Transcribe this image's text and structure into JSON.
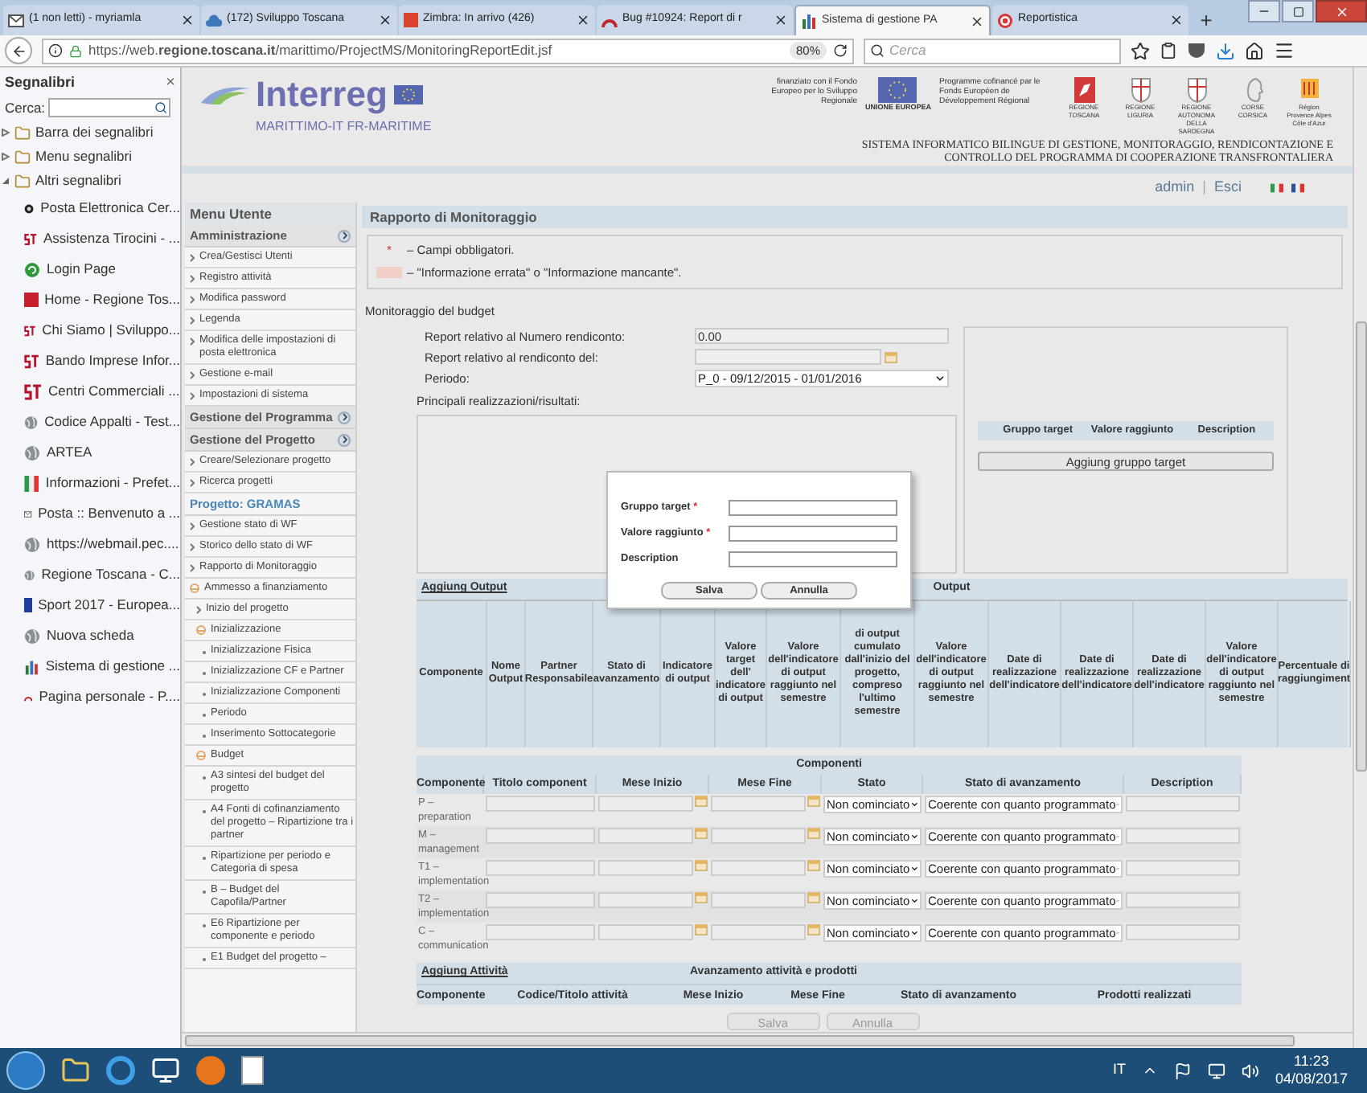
{
  "browser": {
    "tabs": [
      {
        "title": "(1 non letti) - myriamla",
        "kind": "mail",
        "selected": false
      },
      {
        "title": "(172) Sviluppo Toscana",
        "kind": "cloud",
        "selected": false
      },
      {
        "title": "Zimbra: In arrivo (426)",
        "kind": "color",
        "color": "#d9442b",
        "selected": false
      },
      {
        "title": "Bug #10924: Report di r",
        "kind": "arc",
        "selected": false
      },
      {
        "title": "Sistema di gestione PA",
        "kind": "bars",
        "selected": true
      },
      {
        "title": "Reportistica",
        "kind": "target",
        "selected": false
      }
    ],
    "new_tab": "+",
    "url": "https://web.**regione.toscana.it**/marittimo/ProjectMS/MonitoringReportEdit.jsf",
    "zoom": "80%",
    "search_placeholder": "Cerca"
  },
  "bookmarks": {
    "title": "Segnalibri",
    "close": "×",
    "search_label": "Cerca:",
    "folders": [
      {
        "label": "Barra dei segnalibri",
        "expanded": false
      },
      {
        "label": "Menu segnalibri",
        "expanded": false
      },
      {
        "label": "Altri segnalibri",
        "expanded": true,
        "children": [
          {
            "label": "Posta Elettronica Cer...",
            "kind": "dark"
          },
          {
            "label": "Assistenza Tirocini - ...",
            "kind": "st"
          },
          {
            "label": "Login Page",
            "kind": "swirl"
          },
          {
            "label": "Home - Regione Tos...",
            "kind": "color",
            "color": "#c8202f"
          },
          {
            "label": "Chi Siamo | Sviluppo...",
            "kind": "st"
          },
          {
            "label": "Bando Imprese Infor...",
            "kind": "st"
          },
          {
            "label": "Centri Commerciali ...",
            "kind": "st"
          },
          {
            "label": "Codice Appalti - Test...",
            "kind": "globe"
          },
          {
            "label": "ARTEA",
            "kind": "globe"
          },
          {
            "label": "Informazioni - Prefet...",
            "kind": "flag"
          },
          {
            "label": "Posta :: Benvenuto a ...",
            "kind": "mail"
          },
          {
            "label": "https://webmail.pec....",
            "kind": "globe"
          },
          {
            "label": "Regione Toscana - C...",
            "kind": "globe"
          },
          {
            "label": "Sport 2017 - Europea...",
            "kind": "color",
            "color": "#1f3f9e"
          },
          {
            "label": "Nuova scheda",
            "kind": "globe"
          },
          {
            "label": "Sistema di gestione ...",
            "kind": "bars"
          },
          {
            "label": "Pagina personale - P....",
            "kind": "arc"
          }
        ]
      }
    ]
  },
  "header": {
    "logo": "Interreg",
    "programme": "MARITTIMO-IT FR-MARITIME",
    "fund_it": "finanziato con il Fondo Europeo per lo Sviluppo Regionale",
    "eu": "UNIONE EUROPEA",
    "fund_fr": "Programme cofinancé par le Fonds Européen de Développement Régional",
    "regions": [
      {
        "label": "REGIONE TOSCANA",
        "kind": "pegasus"
      },
      {
        "label": "REGIONE LIGURIA",
        "kind": "shield"
      },
      {
        "label": "REGIONE AUTONOMA DELLA SARDEGNA",
        "kind": "shield"
      },
      {
        "label": "CORSE CORSICA",
        "kind": "head"
      },
      {
        "label": "Région Provence Alpes Côte d'Azur",
        "kind": "crest"
      }
    ],
    "system_title": "SISTEMA INFORMATICO BILINGUE DI GESTIONE, MONITORAGGIO, RENDICONTAZIONE E CONTROLLO DEL PROGRAMMA DI COOPERAZIONE TRANSFRONTALIERA"
  },
  "user_bar": {
    "user": "admin",
    "separator": "|",
    "logout": "Esci"
  },
  "menu": {
    "title": "Menu Utente",
    "sections": [
      {
        "title": "Amministrazione",
        "kind": "section",
        "items": [
          {
            "label": "Crea/Gestisci Utenti"
          },
          {
            "label": "Registro attività"
          },
          {
            "label": "Modifica password"
          },
          {
            "label": "Legenda"
          },
          {
            "label": "Modifica delle impostazioni di posta elettronica"
          },
          {
            "label": "Gestione e-mail"
          },
          {
            "label": "Impostazioni di sistema"
          }
        ]
      },
      {
        "title": "Gestione del Programma",
        "kind": "section"
      },
      {
        "title": "Gestione del Progetto",
        "kind": "section",
        "items": [
          {
            "label": "Creare/Selezionare progetto"
          },
          {
            "label": "Ricerca progetti"
          }
        ]
      },
      {
        "title": "Progetto: GRAMAS",
        "kind": "project",
        "items": [
          {
            "label": "Gestione stato di WF"
          },
          {
            "label": "Storico dello stato di WF"
          },
          {
            "label": "Rapporto di Monitoraggio"
          },
          {
            "label": "Ammesso a finanziamento",
            "expanded": true,
            "children": [
              {
                "label": "Inizio del progetto"
              },
              {
                "label": "Inizializzazione",
                "expanded": true,
                "children": [
                  {
                    "label": "Inizializzazione Fisica"
                  },
                  {
                    "label": "Inizializzazione CF e Partner"
                  },
                  {
                    "label": "Inizializzazione Componenti"
                  },
                  {
                    "label": "Periodo"
                  },
                  {
                    "label": "Inserimento Sottocategorie"
                  }
                ]
              },
              {
                "label": "Budget",
                "expanded": true,
                "children": [
                  {
                    "label": "A3 sintesi del budget del progetto"
                  },
                  {
                    "label": "A4 Fonti di cofinanziamento del progetto – Ripartizione tra i partner"
                  },
                  {
                    "label": "Ripartizione per periodo e Categoria di spesa"
                  },
                  {
                    "label": "B – Budget del Capofila/Partner"
                  },
                  {
                    "label": "E6 Ripartizione per componente e periodo"
                  },
                  {
                    "label": "E1 Budget del progetto –"
                  }
                ]
              }
            ]
          }
        ]
      }
    ]
  },
  "main": {
    "title": "Rapporto di Monitoraggio",
    "legend": [
      {
        "kind": "required",
        "mark": "*",
        "text": "– Campi obbligatori."
      },
      {
        "kind": "swatch",
        "text": "– \"Informazione errata\" o \"Informazione mancante\"."
      }
    ],
    "section": "Monitoraggio del budget",
    "fields": [
      {
        "label": "Report relativo al Numero rendiconto:",
        "kind": "text",
        "value": "0.00"
      },
      {
        "label": "Report relativo al rendiconto del:",
        "kind": "date"
      },
      {
        "label": "Periodo:",
        "kind": "select",
        "value": "P_0 - 09/12/2015 - 01/01/2016"
      }
    ],
    "textarea_label": "Principali realizzazioni/risultati:",
    "target_table": {
      "columns": [
        "Gruppo target",
        "Valore raggiunto",
        "Description"
      ],
      "button": "Aggiung gruppo target"
    },
    "output_table": {
      "add_link": "Aggiung Output",
      "title": "Output",
      "columns": [
        "Componente",
        "Nome Output",
        "Partner Responsabile",
        "Stato di avanzamento",
        "Indicatore di output",
        "Valore target dell' indicatore di output",
        "Valore dell'indicatore di output raggiunto nel semestre",
        "di output cumulato dall'inizio del progetto, compreso l'ultimo semestre",
        "Valore dell'indicatore di output raggiunto nel semestre",
        "Date di realizzazione dell'indicatore",
        "Date di realizzazione dell'indicatore",
        "Date di realizzazione dell'indicatore",
        "Valore dell'indicatore di output raggiunto nel semestre",
        "Percentuale di raggiungiment"
      ]
    },
    "components": {
      "title": "Componenti",
      "columns": [
        "Componente",
        "Titolo component",
        "Mese Inizio",
        "Mese Fine",
        "Stato",
        "Stato di avanzamento",
        "Description"
      ],
      "rows": [
        {
          "component": "P – preparation",
          "status": "Non cominciato",
          "progress": "Coerente con quanto programmato"
        },
        {
          "component": "M – management",
          "status": "Non cominciato",
          "progress": "Coerente con quanto programmato"
        },
        {
          "component": "T1 – implementation",
          "status": "Non cominciato",
          "progress": "Coerente con quanto programmato"
        },
        {
          "component": "T2 – implementation",
          "status": "Non cominciato",
          "progress": "Coerente con quanto programmato"
        },
        {
          "component": "C – communication",
          "status": "Non cominciato",
          "progress": "Coerente con quanto programmato"
        }
      ]
    },
    "activities": {
      "add_link": "Aggiung Attività",
      "title": "Avanzamento attività e prodotti",
      "columns": [
        "Componente",
        "Codice/Titolo attività",
        "Mese Inizio",
        "Mese Fine",
        "Stato di avanzamento",
        "Prodotti realizzati"
      ]
    },
    "buttons": [
      {
        "label": "Salva",
        "disabled": true
      },
      {
        "label": "Annulla",
        "disabled": true
      }
    ]
  },
  "dialog": {
    "fields": [
      {
        "label": "Gruppo target",
        "mark": "*"
      },
      {
        "label": "Valore raggiunto",
        "mark": "*"
      },
      {
        "label": "Description"
      }
    ],
    "buttons": [
      "Salva",
      "Annulla"
    ]
  },
  "taskbar": {
    "language": "IT",
    "time": "11:23",
    "date": "04/08/2017"
  }
}
